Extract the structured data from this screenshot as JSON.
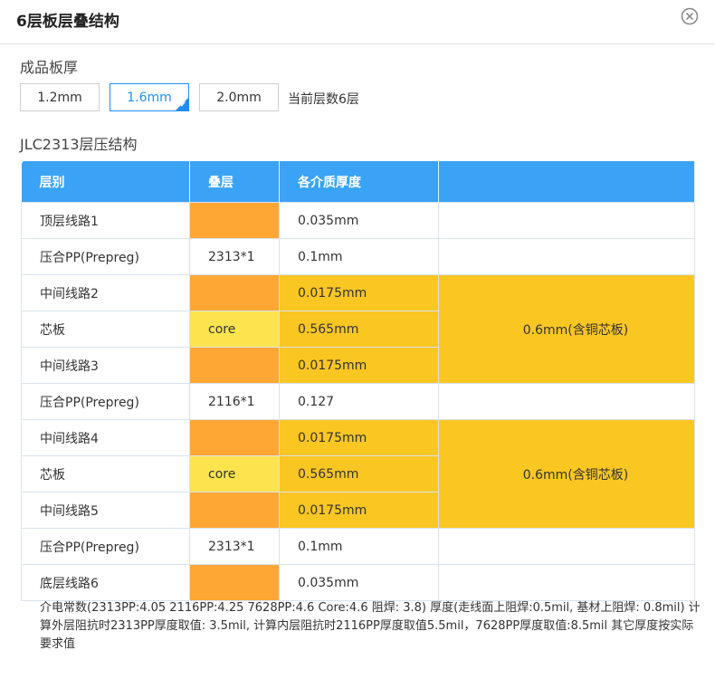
{
  "dialog": {
    "title": "6层板层叠结构"
  },
  "thickness": {
    "label": "成品板厚",
    "options": [
      "1.2mm",
      "1.6mm",
      "2.0mm"
    ],
    "selected": "1.6mm",
    "layer_count": "当前层数6层"
  },
  "structure": {
    "label": "JLC2313层压结构",
    "headers": [
      "层别",
      "叠层",
      "各介质厚度",
      ""
    ],
    "rows": [
      {
        "layer": "顶层线路1",
        "stack": "",
        "thickness": "0.035mm"
      },
      {
        "layer": "压合PP(Prepreg)",
        "stack": "2313*1",
        "thickness": "0.1mm"
      },
      {
        "layer": "中间线路2",
        "stack": "",
        "thickness": "0.0175mm"
      },
      {
        "layer": "芯板",
        "stack": "core",
        "thickness": "0.565mm"
      },
      {
        "layer": "中间线路3",
        "stack": "",
        "thickness": "0.0175mm"
      },
      {
        "layer": "压合PP(Prepreg)",
        "stack": "2116*1",
        "thickness": "0.127"
      },
      {
        "layer": "中间线路4",
        "stack": "",
        "thickness": "0.0175mm"
      },
      {
        "layer": "芯板",
        "stack": "core",
        "thickness": "0.565mm"
      },
      {
        "layer": "中间线路5",
        "stack": "",
        "thickness": "0.0175mm"
      },
      {
        "layer": "压合PP(Prepreg)",
        "stack": "2313*1",
        "thickness": "0.1mm"
      },
      {
        "layer": "底层线路6",
        "stack": "",
        "thickness": "0.035mm"
      }
    ],
    "core_group_1": "0.6mm(含铜芯板)",
    "core_group_2": "0.6mm(含铜芯板)",
    "colors": {
      "copper": "#ffa734",
      "core": "#fde44f",
      "core_group": "#fac622",
      "header": "#3aa3f5",
      "accent": "#1f8ef1"
    }
  },
  "note": "介电常数(2313PP:4.05 2116PP:4.25 7628PP:4.6 Core:4.6 阻焊: 3.8) 厚度(走线面上阻焊:0.5mil, 基材上阻焊: 0.8mil) 计算外层阻抗时2313PP厚度取值: 3.5mil, 计算内层阻抗时2116PP厚度取值5.5mil，7628PP厚度取值:8.5mil 其它厚度按实际要求值"
}
